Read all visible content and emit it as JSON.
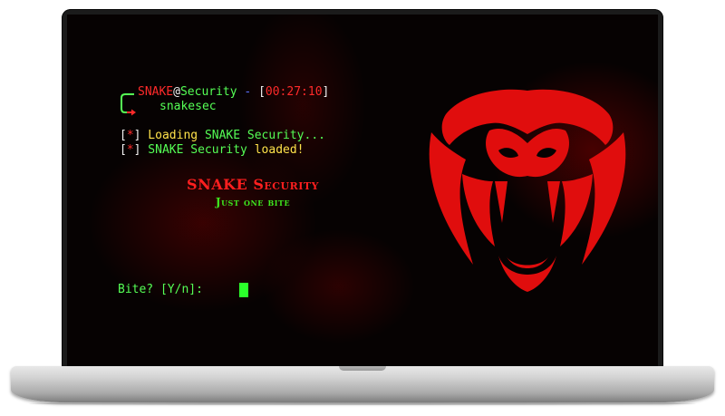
{
  "terminal": {
    "prompt": {
      "user": "SNAKE",
      "at": "@",
      "host": "Security",
      "separator": " - ",
      "time_open": "[",
      "time": "00:27:10",
      "time_close": "]",
      "command": "snakesec"
    },
    "log": [
      {
        "bracket_open": "[",
        "mark": "*",
        "bracket_close": "]",
        "text_a": " Loading ",
        "text_b": "SNAKE Security...",
        "text_c": ""
      },
      {
        "bracket_open": "[",
        "mark": "*",
        "bracket_close": "]",
        "text_a": " SNAKE Security ",
        "text_b": "loaded!",
        "text_c": ""
      }
    ],
    "brand": {
      "title": "SNAKE Security",
      "subtitle": "Just one bite"
    },
    "input_prompt": "Bite? [Y/n]: "
  },
  "colors": {
    "accent_red": "#ff2a2a",
    "terminal_green": "#55ff55",
    "terminal_yellow": "#ffe34a",
    "separator_blue": "#5a72ff",
    "cursor_green": "#2bff2b"
  },
  "icons": {
    "logo": "snake-head-icon",
    "prompt_arrow": "arrow-right-icon"
  }
}
